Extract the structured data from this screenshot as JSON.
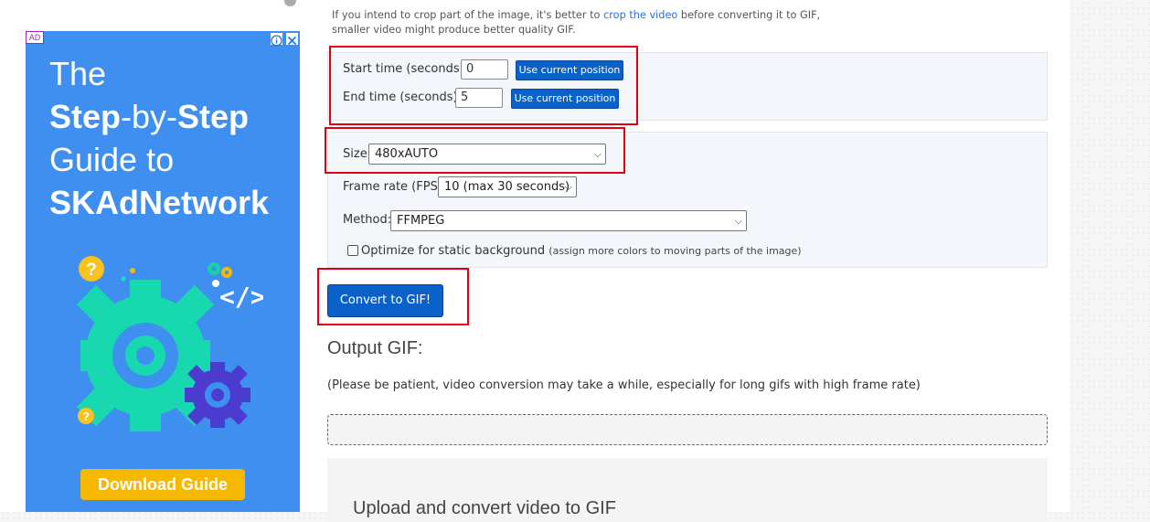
{
  "ad": {
    "badge": "AD",
    "headline_line1": "The",
    "headline_line2_a": "Step",
    "headline_line2_b": "-by-",
    "headline_line2_c": "Step",
    "headline_line3": "Guide to",
    "headline_line4": "SKAdNetwork",
    "cta": "Download Guide",
    "icons": [
      "info-icon",
      "close-icon",
      "question-icon",
      "gear-icon",
      "code-icon"
    ]
  },
  "note": {
    "line1_prefix": "If you intend to crop part of the image, it's better to ",
    "line1_link": "crop the video",
    "line1_suffix": " before converting it to GIF,",
    "line2": "smaller video might produce better quality GIF."
  },
  "time": {
    "start_label": "Start time (seconds):",
    "start_value": "0",
    "end_label": "End time (seconds):",
    "end_value": "5",
    "use_position_label": "Use current position"
  },
  "options": {
    "size_label": "Size:",
    "size_value": "480xAUTO",
    "fps_label": "Frame rate (FPS):",
    "fps_value": "10 (max 30 seconds)",
    "method_label": "Method:",
    "method_value": "FFMPEG",
    "optimize_label": "Optimize for static background",
    "optimize_note": "(assign more colors to moving parts of the image)",
    "optimize_checked": false
  },
  "convert_button": "Convert to GIF!",
  "output": {
    "title": "Output GIF:",
    "patience": "(Please be patient, video conversion may take a while, especially for long gifs with high frame rate)"
  },
  "upload": {
    "title": "Upload and convert video to GIF"
  },
  "colors": {
    "accent": "#0a62c9",
    "highlight": "#e1000f",
    "ad_background": "#3f8ff0",
    "ad_cta": "#f7b800"
  }
}
